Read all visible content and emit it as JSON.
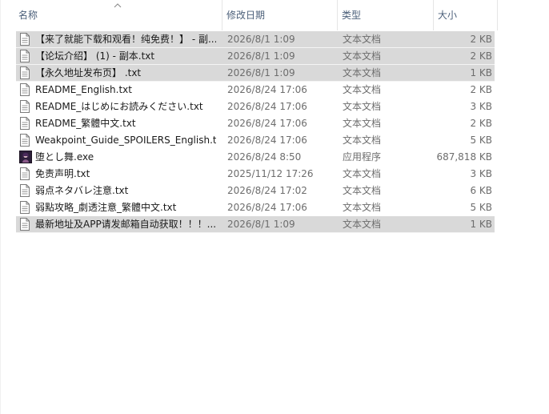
{
  "columns": {
    "name": "名称",
    "date": "修改日期",
    "type": "类型",
    "size": "大小"
  },
  "sort": {
    "column": "name",
    "icon": "sort-up-icon"
  },
  "files": [
    {
      "name": "【来了就能下载和观看！纯免费！】 - 副...",
      "date": "2026/8/1 1:09",
      "type": "文本文档",
      "size": "2 KB",
      "icon": "text-document-icon",
      "selected": true
    },
    {
      "name": "【论坛介绍】 (1) - 副本.txt",
      "date": "2026/8/1 1:09",
      "type": "文本文档",
      "size": "2 KB",
      "icon": "text-document-icon",
      "selected": true
    },
    {
      "name": "【永久地址发布页】 .txt",
      "date": "2026/8/1 1:09",
      "type": "文本文档",
      "size": "1 KB",
      "icon": "text-document-icon",
      "selected": true
    },
    {
      "name": "README_English.txt",
      "date": "2026/8/24 17:06",
      "type": "文本文档",
      "size": "2 KB",
      "icon": "text-document-icon",
      "selected": false
    },
    {
      "name": "README_はじめにお読みください.txt",
      "date": "2026/8/24 17:06",
      "type": "文本文档",
      "size": "3 KB",
      "icon": "text-document-icon",
      "selected": false
    },
    {
      "name": "README_繁體中文.txt",
      "date": "2026/8/24 17:06",
      "type": "文本文档",
      "size": "2 KB",
      "icon": "text-document-icon",
      "selected": false
    },
    {
      "name": "Weakpoint_Guide_SPOILERS_English.txt",
      "date": "2026/8/24 17:06",
      "type": "文本文档",
      "size": "5 KB",
      "icon": "text-document-icon",
      "selected": false
    },
    {
      "name": "堕とし舞.exe",
      "date": "2026/8/24 8:50",
      "type": "应用程序",
      "size": "687,818 KB",
      "icon": "application-icon",
      "selected": false
    },
    {
      "name": "免责声明.txt",
      "date": "2025/11/12 17:26",
      "type": "文本文档",
      "size": "3 KB",
      "icon": "text-document-icon",
      "selected": false
    },
    {
      "name": "弱点ネタバレ注意.txt",
      "date": "2026/8/24 17:02",
      "type": "文本文档",
      "size": "6 KB",
      "icon": "text-document-icon",
      "selected": false
    },
    {
      "name": "弱點攻略_劇透注意_繁體中文.txt",
      "date": "2026/8/24 17:06",
      "type": "文本文档",
      "size": "5 KB",
      "icon": "text-document-icon",
      "selected": false
    },
    {
      "name": "最新地址及APP请发邮箱自动获取！！！...",
      "date": "2026/8/1 1:09",
      "type": "文本文档",
      "size": "1 KB",
      "icon": "text-document-icon",
      "selected": true
    }
  ]
}
